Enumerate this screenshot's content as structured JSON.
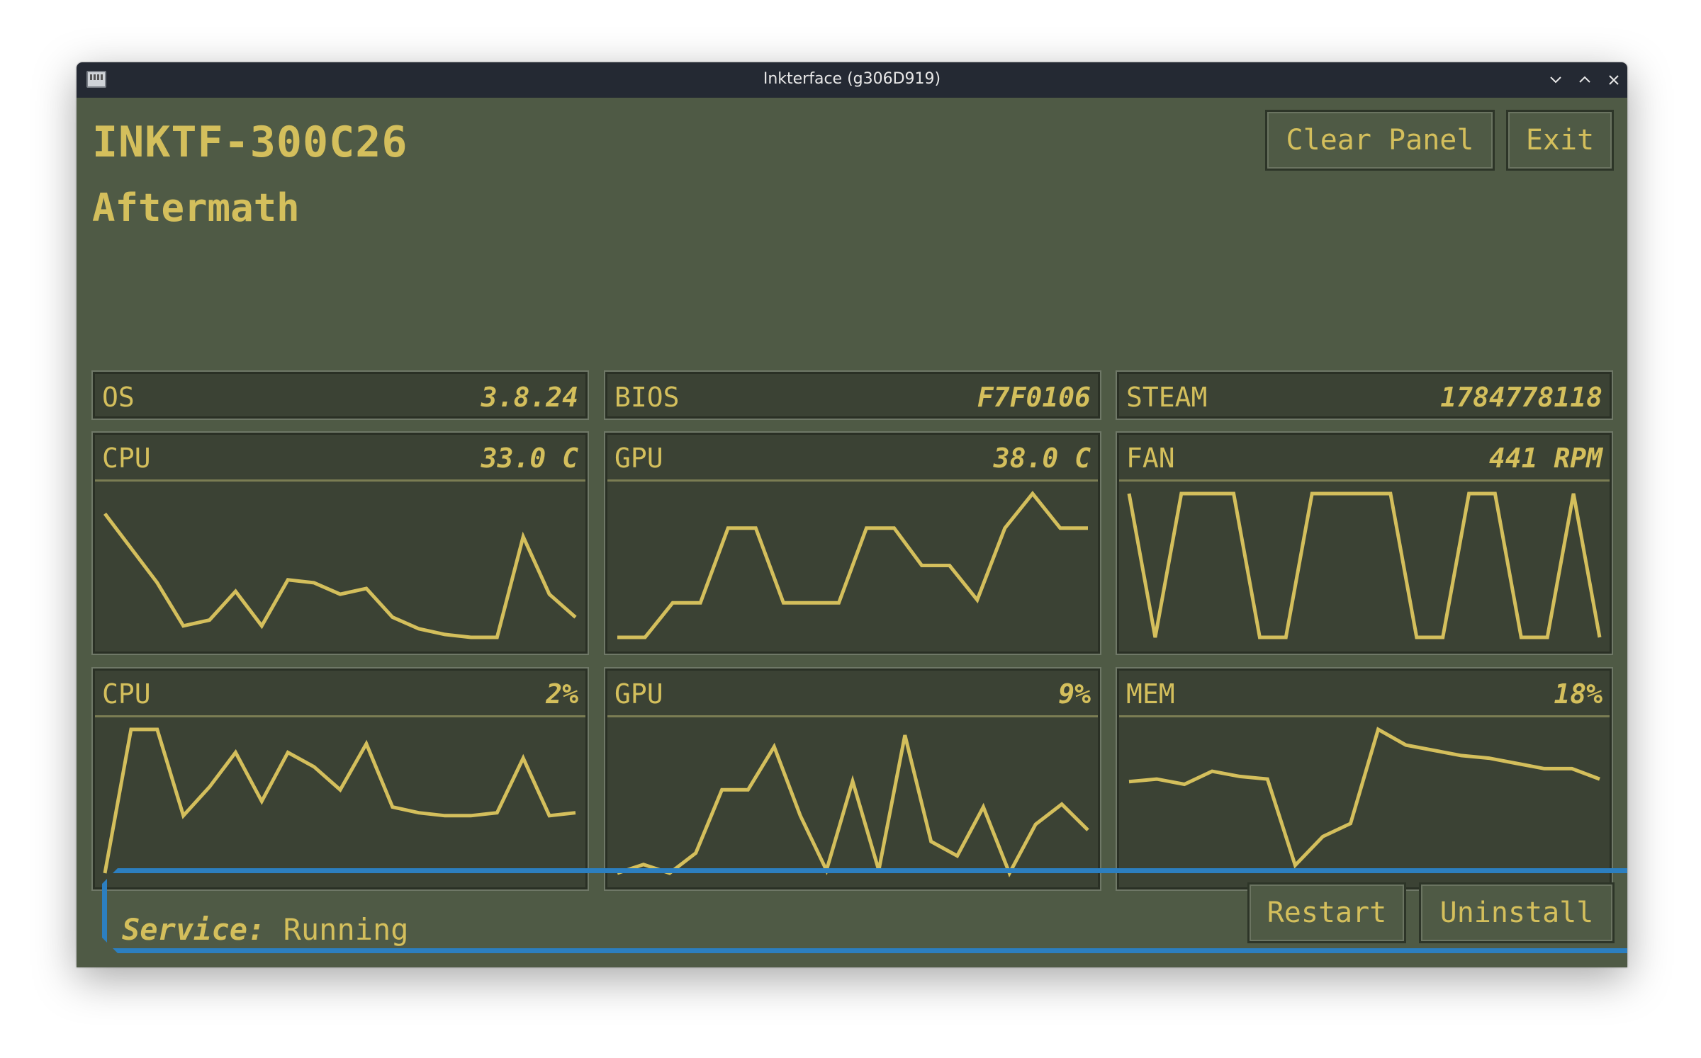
{
  "window": {
    "title": "Inkterface (g306D919)"
  },
  "header": {
    "hostname": "INKTF-300C26",
    "game": "Aftermath",
    "clear_label": "Clear Panel",
    "exit_label": "Exit"
  },
  "info": [
    {
      "label": "OS",
      "value": "3.8.24"
    },
    {
      "label": "BIOS",
      "value": "F7F0106"
    },
    {
      "label": "STEAM",
      "value": "1784778118"
    }
  ],
  "graphs": [
    {
      "label": "CPU",
      "value": "33.0 C"
    },
    {
      "label": "GPU",
      "value": "38.0 C"
    },
    {
      "label": "FAN",
      "value": "441 RPM"
    },
    {
      "label": "CPU",
      "value": "2%"
    },
    {
      "label": "GPU",
      "value": "9%"
    },
    {
      "label": "MEM",
      "value": "18%"
    }
  ],
  "chart_data": [
    {
      "type": "line",
      "name": "cpu-temp",
      "values": [
        86,
        62,
        38,
        8,
        12,
        32,
        8,
        40,
        38,
        30,
        34,
        14,
        6,
        2,
        0,
        0,
        70,
        30,
        14
      ]
    },
    {
      "type": "line",
      "name": "gpu-temp",
      "values": [
        0,
        0,
        24,
        24,
        76,
        76,
        24,
        24,
        24,
        76,
        76,
        50,
        50,
        26,
        76,
        100,
        76,
        76
      ]
    },
    {
      "type": "line",
      "name": "fan",
      "values": [
        100,
        0,
        100,
        100,
        100,
        0,
        0,
        100,
        100,
        100,
        100,
        0,
        0,
        100,
        100,
        0,
        0,
        100,
        0
      ]
    },
    {
      "type": "line",
      "name": "cpu-load",
      "values": [
        0,
        100,
        100,
        40,
        60,
        84,
        50,
        84,
        74,
        58,
        90,
        46,
        42,
        40,
        40,
        42,
        80,
        40,
        42
      ]
    },
    {
      "type": "line",
      "name": "gpu-load",
      "values": [
        0,
        6,
        0,
        14,
        58,
        58,
        88,
        40,
        2,
        64,
        2,
        96,
        22,
        12,
        46,
        0,
        34,
        48,
        30
      ]
    },
    {
      "type": "line",
      "name": "mem",
      "values": [
        70,
        72,
        68,
        78,
        74,
        72,
        6,
        28,
        38,
        110,
        98,
        94,
        90,
        88,
        84,
        80,
        80,
        72
      ]
    }
  ],
  "service": {
    "key": "Service:",
    "state": "Running",
    "restart_label": "Restart",
    "uninstall_label": "Uninstall"
  },
  "colors": {
    "background": "#4f5a45",
    "panel": "#3b4234",
    "accent": "#d4bf5c",
    "status_border": "#2c7fc0",
    "titlebar": "#242933"
  }
}
